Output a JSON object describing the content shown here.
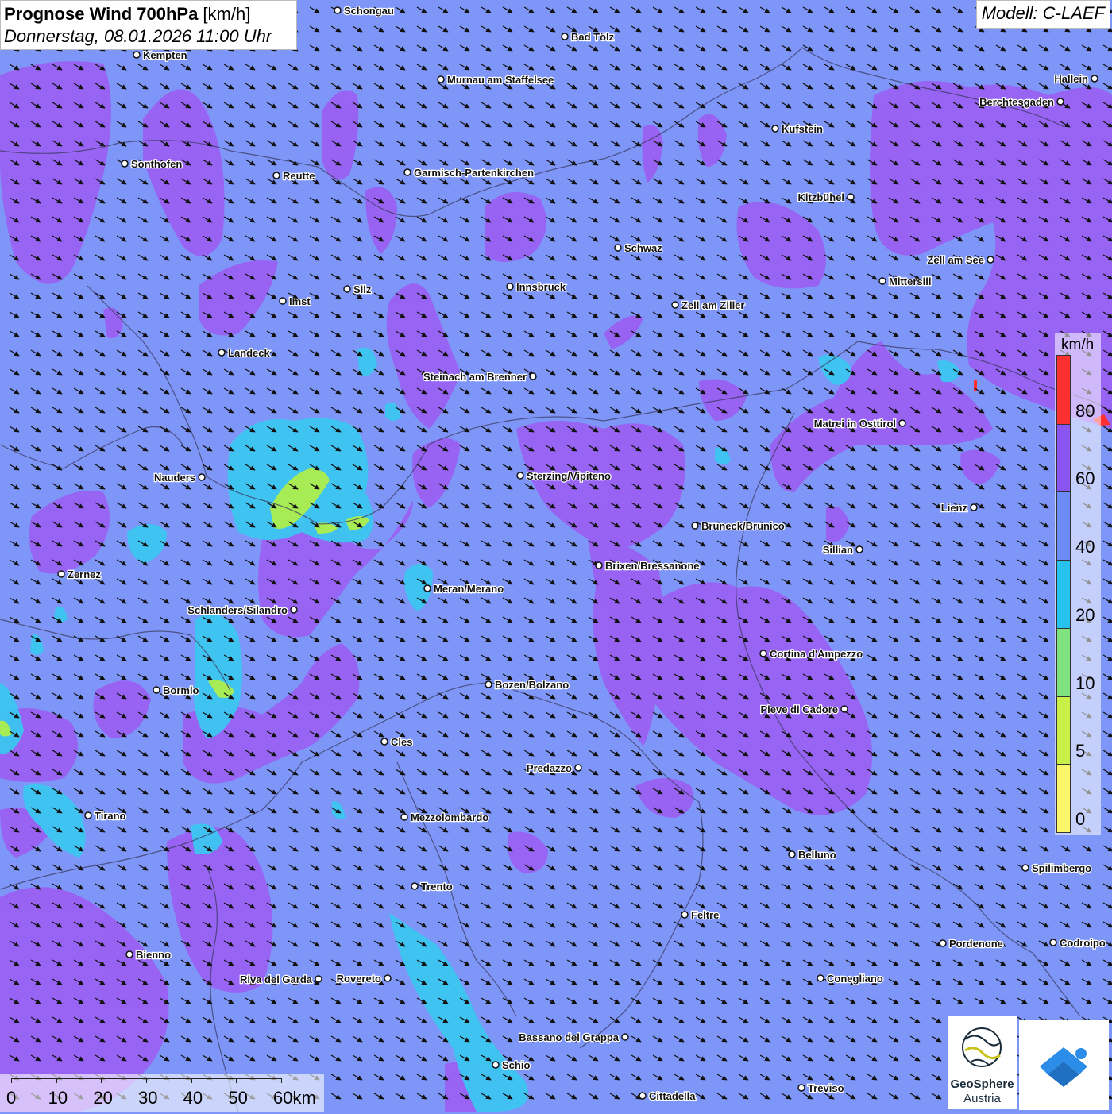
{
  "title": {
    "bold": "Prognose Wind 700hPa",
    "unit": " [km/h]",
    "datetime": "Donnerstag, 08.01.2026 11:00 Uhr"
  },
  "model": "Modell: C-LAEF",
  "legend": {
    "unit": "km/h",
    "labels": [
      "80",
      "60",
      "40",
      "20",
      "10",
      "5",
      "0"
    ],
    "colors": [
      "#ff3030",
      "#8a55f0",
      "#6a8cf4",
      "#27c3ee",
      "#7fe27f",
      "#c8f048",
      "#fbf56a"
    ]
  },
  "scale": [
    "0",
    "10",
    "20",
    "30",
    "40",
    "50",
    "60km"
  ],
  "logo": {
    "line1": "GeoSphere",
    "line2": "Austria"
  },
  "colors": {
    "background": "#7e96f7",
    "purple": "#9b5ef2",
    "cyan": "#3cc6f0",
    "green": "#a8ec55",
    "red": "#ff3030",
    "logo_blue": "#2c8de8"
  },
  "cities": [
    {
      "name": "Schongau"
    },
    {
      "name": "Bad Tölz"
    },
    {
      "name": "Kempten"
    },
    {
      "name": "Murnau am Staffelsee"
    },
    {
      "name": "Hallein"
    },
    {
      "name": "Berchtesgaden"
    },
    {
      "name": "Kufstein"
    },
    {
      "name": "Sonthofen"
    },
    {
      "name": "Reutte"
    },
    {
      "name": "Garmisch-Partenkirchen"
    },
    {
      "name": "Kitzbühel"
    },
    {
      "name": "Schwaz"
    },
    {
      "name": "Zell am See"
    },
    {
      "name": "Mittersill"
    },
    {
      "name": "Silz"
    },
    {
      "name": "Innsbruck"
    },
    {
      "name": "Imst"
    },
    {
      "name": "Zell am Ziller"
    },
    {
      "name": "Landeck"
    },
    {
      "name": "Steinach am Brenner"
    },
    {
      "name": "Matrei in Osttirol"
    },
    {
      "name": "Nauders"
    },
    {
      "name": "Sterzing/Vipiteno"
    },
    {
      "name": "Lienz"
    },
    {
      "name": "Bruneck/Brunico"
    },
    {
      "name": "Sillian"
    },
    {
      "name": "Zernez"
    },
    {
      "name": "Brixen/Bressanone"
    },
    {
      "name": "Meran/Merano"
    },
    {
      "name": "Schlanders/Silandro"
    },
    {
      "name": "Cortina d'Ampezzo"
    },
    {
      "name": "Bozen/Bolzano"
    },
    {
      "name": "Bormio"
    },
    {
      "name": "Pieve di Cadore"
    },
    {
      "name": "Cles"
    },
    {
      "name": "Predazzo"
    },
    {
      "name": "Tirano"
    },
    {
      "name": "Mezzolombardo"
    },
    {
      "name": "Belluno"
    },
    {
      "name": "Spilimbergo"
    },
    {
      "name": "Trento"
    },
    {
      "name": "Feltre"
    },
    {
      "name": "Bienno"
    },
    {
      "name": "Pordenone"
    },
    {
      "name": "Codroipo"
    },
    {
      "name": "Riva del Garda"
    },
    {
      "name": "Rovereto"
    },
    {
      "name": "Conegliano"
    },
    {
      "name": "Bassano del Grappa"
    },
    {
      "name": "Schio"
    },
    {
      "name": "Treviso"
    },
    {
      "name": "Cittadella"
    }
  ]
}
